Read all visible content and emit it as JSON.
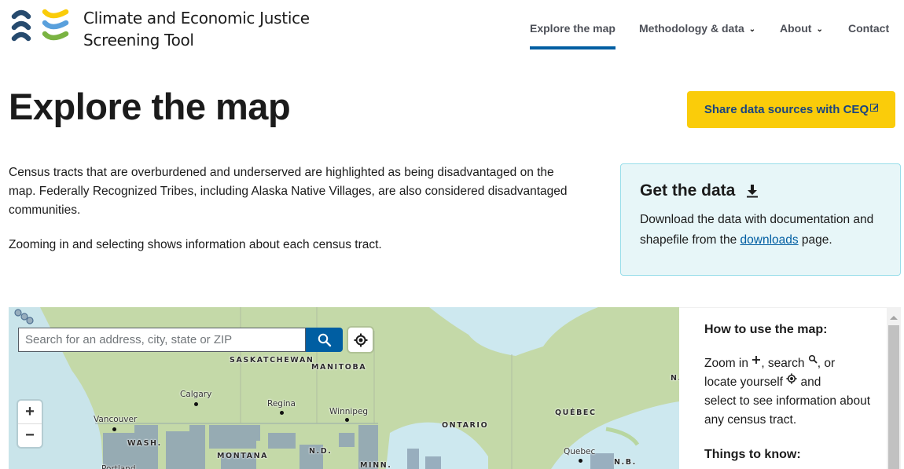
{
  "header": {
    "site_title_line1": "Climate and Economic Justice",
    "site_title_line2": "Screening Tool",
    "logo_colors": {
      "navy": "#264a6e",
      "yellow": "#facc0a",
      "blue": "#5aa0dc",
      "green": "#7ab342"
    },
    "nav": [
      {
        "label": "Explore the map",
        "active": true,
        "has_dropdown": false
      },
      {
        "label": "Methodology & data",
        "active": false,
        "has_dropdown": true
      },
      {
        "label": "About",
        "active": false,
        "has_dropdown": true
      },
      {
        "label": "Contact",
        "active": false,
        "has_dropdown": false
      }
    ]
  },
  "page": {
    "title": "Explore the map",
    "share_button_label": "Share data sources with CEQ",
    "intro_p1": "Census tracts that are overburdened and underserved are highlighted as being disadvantaged on the map. Federally Recognized Tribes, including Alaska Native Villages, are also considered disadvantaged communities.",
    "intro_p2": "Zooming in and selecting shows information about each census tract."
  },
  "data_card": {
    "title": "Get the data",
    "text_before": "Download the data with documentation and shapefile from the ",
    "link_label": "downloads",
    "text_after": " page."
  },
  "map": {
    "search_placeholder": "Search for an address, city, state or ZIP",
    "search_value": "",
    "zoom_in_label": "+",
    "zoom_out_label": "−",
    "region_labels": [
      "SASKATCHEWAN",
      "MANITOBA",
      "ONTARIO",
      "QUÉBEC",
      "WASH.",
      "MONTANA",
      "N.D.",
      "MINN.",
      "N.B.",
      "N."
    ],
    "city_labels": [
      "Calgary",
      "Regina",
      "Winnipeg",
      "Vancouver",
      "Quebec",
      "Portland"
    ]
  },
  "side_panel": {
    "heading1": "How to use the map:",
    "zoom_text": "Zoom in ",
    "search_text": ", search ",
    "or_text": ", or",
    "locate_text": "locate yourself ",
    "and_text": " and",
    "select_text": "select to see information about any census tract.",
    "heading2": "Things to know:"
  }
}
